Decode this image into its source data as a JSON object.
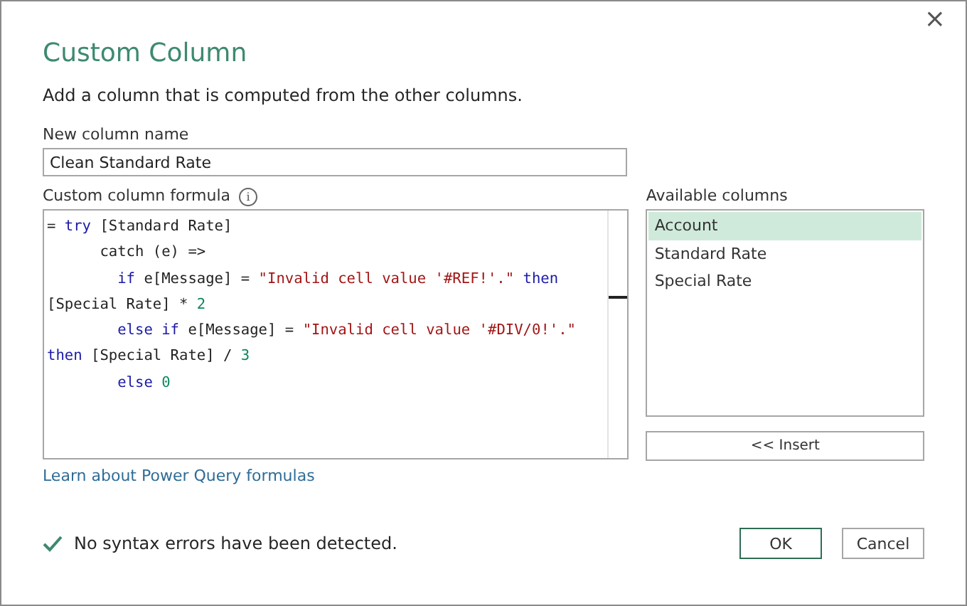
{
  "window": {
    "close": "×"
  },
  "title": "Custom Column",
  "subtitle": "Add a column that is computed from the other columns.",
  "name_field": {
    "label": "New column name",
    "value": "Clean Standard Rate"
  },
  "formula": {
    "label": "Custom column formula",
    "info": "i",
    "lines": [
      [
        {
          "kind": "plain",
          "text": "= "
        },
        {
          "kind": "keyword",
          "text": "try"
        },
        {
          "kind": "plain",
          "text": " [Standard Rate]"
        }
      ],
      [
        {
          "kind": "plain",
          "text": "      catch (e) =>"
        }
      ],
      [
        {
          "kind": "keyword",
          "text": "        if"
        },
        {
          "kind": "plain",
          "text": " e[Message] = "
        },
        {
          "kind": "string",
          "text": "\"Invalid cell value '#REF!'.\""
        },
        {
          "kind": "keyword",
          "text": " then"
        }
      ],
      [
        {
          "kind": "plain",
          "text": "[Special Rate] * "
        },
        {
          "kind": "number",
          "text": "2"
        }
      ],
      [
        {
          "kind": "keyword",
          "text": "        else"
        },
        {
          "kind": "keyword",
          "text": " if"
        },
        {
          "kind": "plain",
          "text": " e[Message] = "
        },
        {
          "kind": "string",
          "text": "\"Invalid cell value '#DIV/0!'.\""
        }
      ],
      [
        {
          "kind": "keyword",
          "text": "then"
        },
        {
          "kind": "plain",
          "text": " [Special Rate] / "
        },
        {
          "kind": "number",
          "text": "3"
        }
      ],
      [
        {
          "kind": "keyword",
          "text": "        else"
        },
        {
          "kind": "number",
          "text": " 0"
        }
      ]
    ]
  },
  "available_columns": {
    "label": "Available columns",
    "items": [
      {
        "label": "Account",
        "selected": true
      },
      {
        "label": "Standard Rate",
        "selected": false
      },
      {
        "label": "Special Rate",
        "selected": false
      }
    ],
    "insert_button": "<< Insert"
  },
  "link": "Learn about Power Query formulas",
  "status": {
    "ok": true,
    "text": "No syntax errors have been detected."
  },
  "buttons": [
    "OK",
    "Cancel"
  ]
}
